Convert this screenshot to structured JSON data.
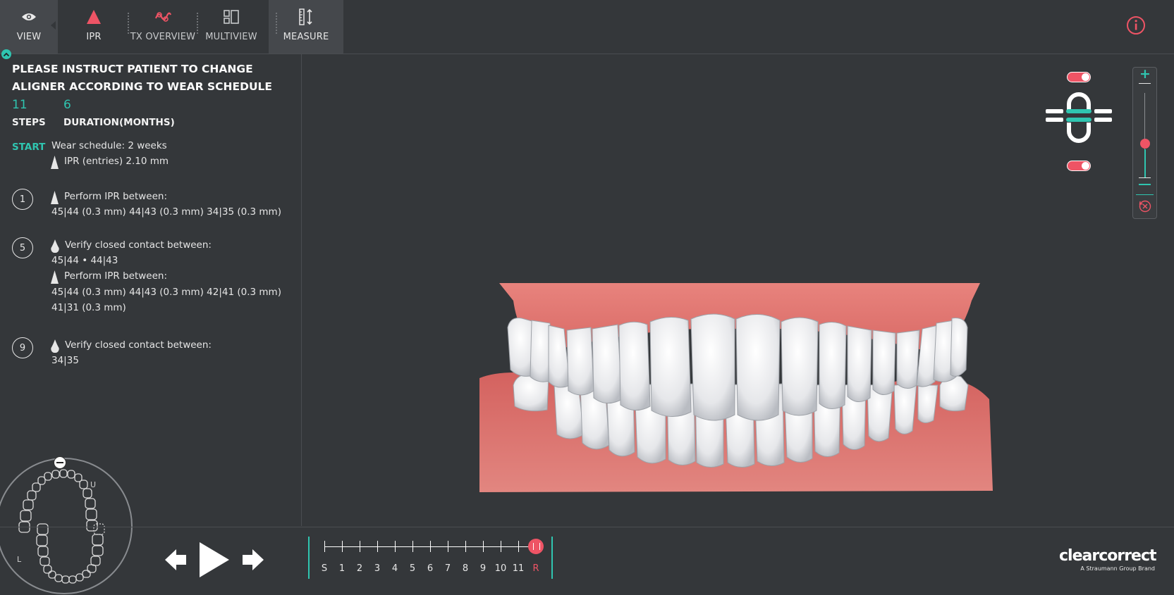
{
  "toolbar": {
    "tabs": [
      {
        "label": "VIEW",
        "icon": "eye-icon",
        "active": true
      },
      {
        "label": "IPR",
        "icon": "ipr-triangle-icon",
        "active": false
      },
      {
        "label": "TX OVERVIEW",
        "icon": "tx-overview-icon",
        "active": false
      },
      {
        "label": "MULTIVIEW",
        "icon": "multiview-icon",
        "active": false
      },
      {
        "label": "MEASURE",
        "icon": "measure-icon",
        "active": true
      }
    ],
    "info_icon": "info-icon"
  },
  "panel": {
    "notice": "PLEASE INSTRUCT PATIENT TO CHANGE ALIGNER ACCORDING TO WEAR SCHEDULE",
    "steps_value": "11",
    "steps_label": "STEPS",
    "duration_value": "6",
    "duration_label": "DURATION(MONTHS)",
    "start_label": "START",
    "start_lines": [
      "Wear schedule: 2 weeks",
      "IPR (entries) 2.10 mm"
    ],
    "events": [
      {
        "step": "1",
        "items": [
          {
            "icon": "ipr-triangle-icon",
            "title": "Perform IPR between:",
            "detail": "45|44 (0.3 mm) 44|43 (0.3 mm) 34|35 (0.3 mm)"
          }
        ]
      },
      {
        "step": "5",
        "items": [
          {
            "icon": "contact-drop-icon",
            "title": "Verify closed contact between:",
            "detail": "45|44 • 44|43"
          },
          {
            "icon": "ipr-triangle-icon",
            "title": "Perform IPR between:",
            "detail": "45|44 (0.3 mm) 44|43 (0.3 mm) 42|41 (0.3 mm) 41|31 (0.3 mm)"
          }
        ]
      },
      {
        "step": "9",
        "items": [
          {
            "icon": "contact-drop-icon",
            "title": "Verify closed contact between:",
            "detail": "34|35"
          }
        ]
      }
    ]
  },
  "toothmap": {
    "upper_label": "U",
    "left_label": "L"
  },
  "timeline": {
    "labels": [
      "S",
      "1",
      "2",
      "3",
      "4",
      "5",
      "6",
      "7",
      "8",
      "9",
      "10",
      "11",
      "R"
    ],
    "current": "R"
  },
  "zoom": {
    "plus": "+",
    "minus": "−",
    "level": 0.45
  },
  "brand": {
    "name": "clearcorrect",
    "tagline": "A Straumann Group Brand"
  },
  "colors": {
    "accent": "#2fc5b0",
    "alert": "#ee5465",
    "background": "#34373a"
  }
}
